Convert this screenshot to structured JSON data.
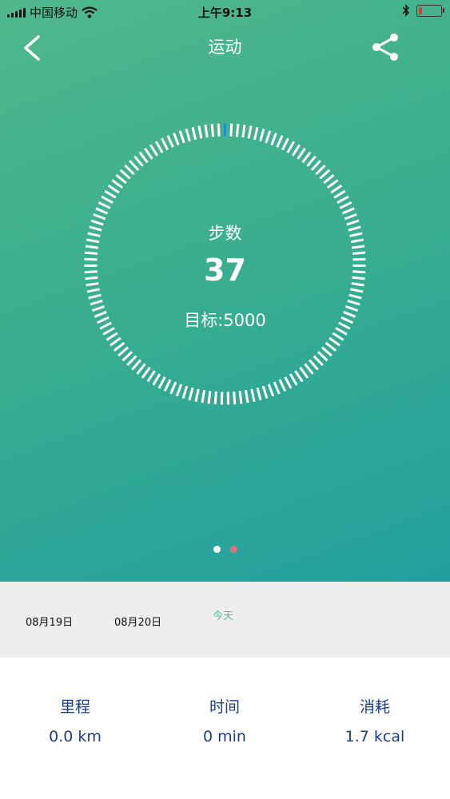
{
  "status_bar": {
    "carrier": "中国移动",
    "time": "上午9:13"
  },
  "nav": {
    "title": "运动",
    "back_icon": "chevron-left-icon",
    "share_icon": "share-icon"
  },
  "ring": {
    "label": "步数",
    "steps": "37",
    "goal_text": "目标:5000",
    "progress_fraction": 0.0074,
    "colors": {
      "track": "#ffffff",
      "progress": "#1a8fc9"
    }
  },
  "pager": {
    "pages": 2,
    "active_index": 0
  },
  "dates": [
    {
      "label": "08月19日"
    },
    {
      "label": "08月20日"
    },
    {
      "label": "今天",
      "selected": true
    }
  ],
  "stats": [
    {
      "label": "里程",
      "value": "0.0 km"
    },
    {
      "label": "时间",
      "value": "0 min"
    },
    {
      "label": "消耗",
      "value": "1.7 kcal"
    }
  ],
  "colors": {
    "accent_text": "#1a3d8f",
    "today_text": "#5cb99a",
    "hero_gradient_start": "#50b88c",
    "hero_gradient_end": "#22a09e"
  }
}
